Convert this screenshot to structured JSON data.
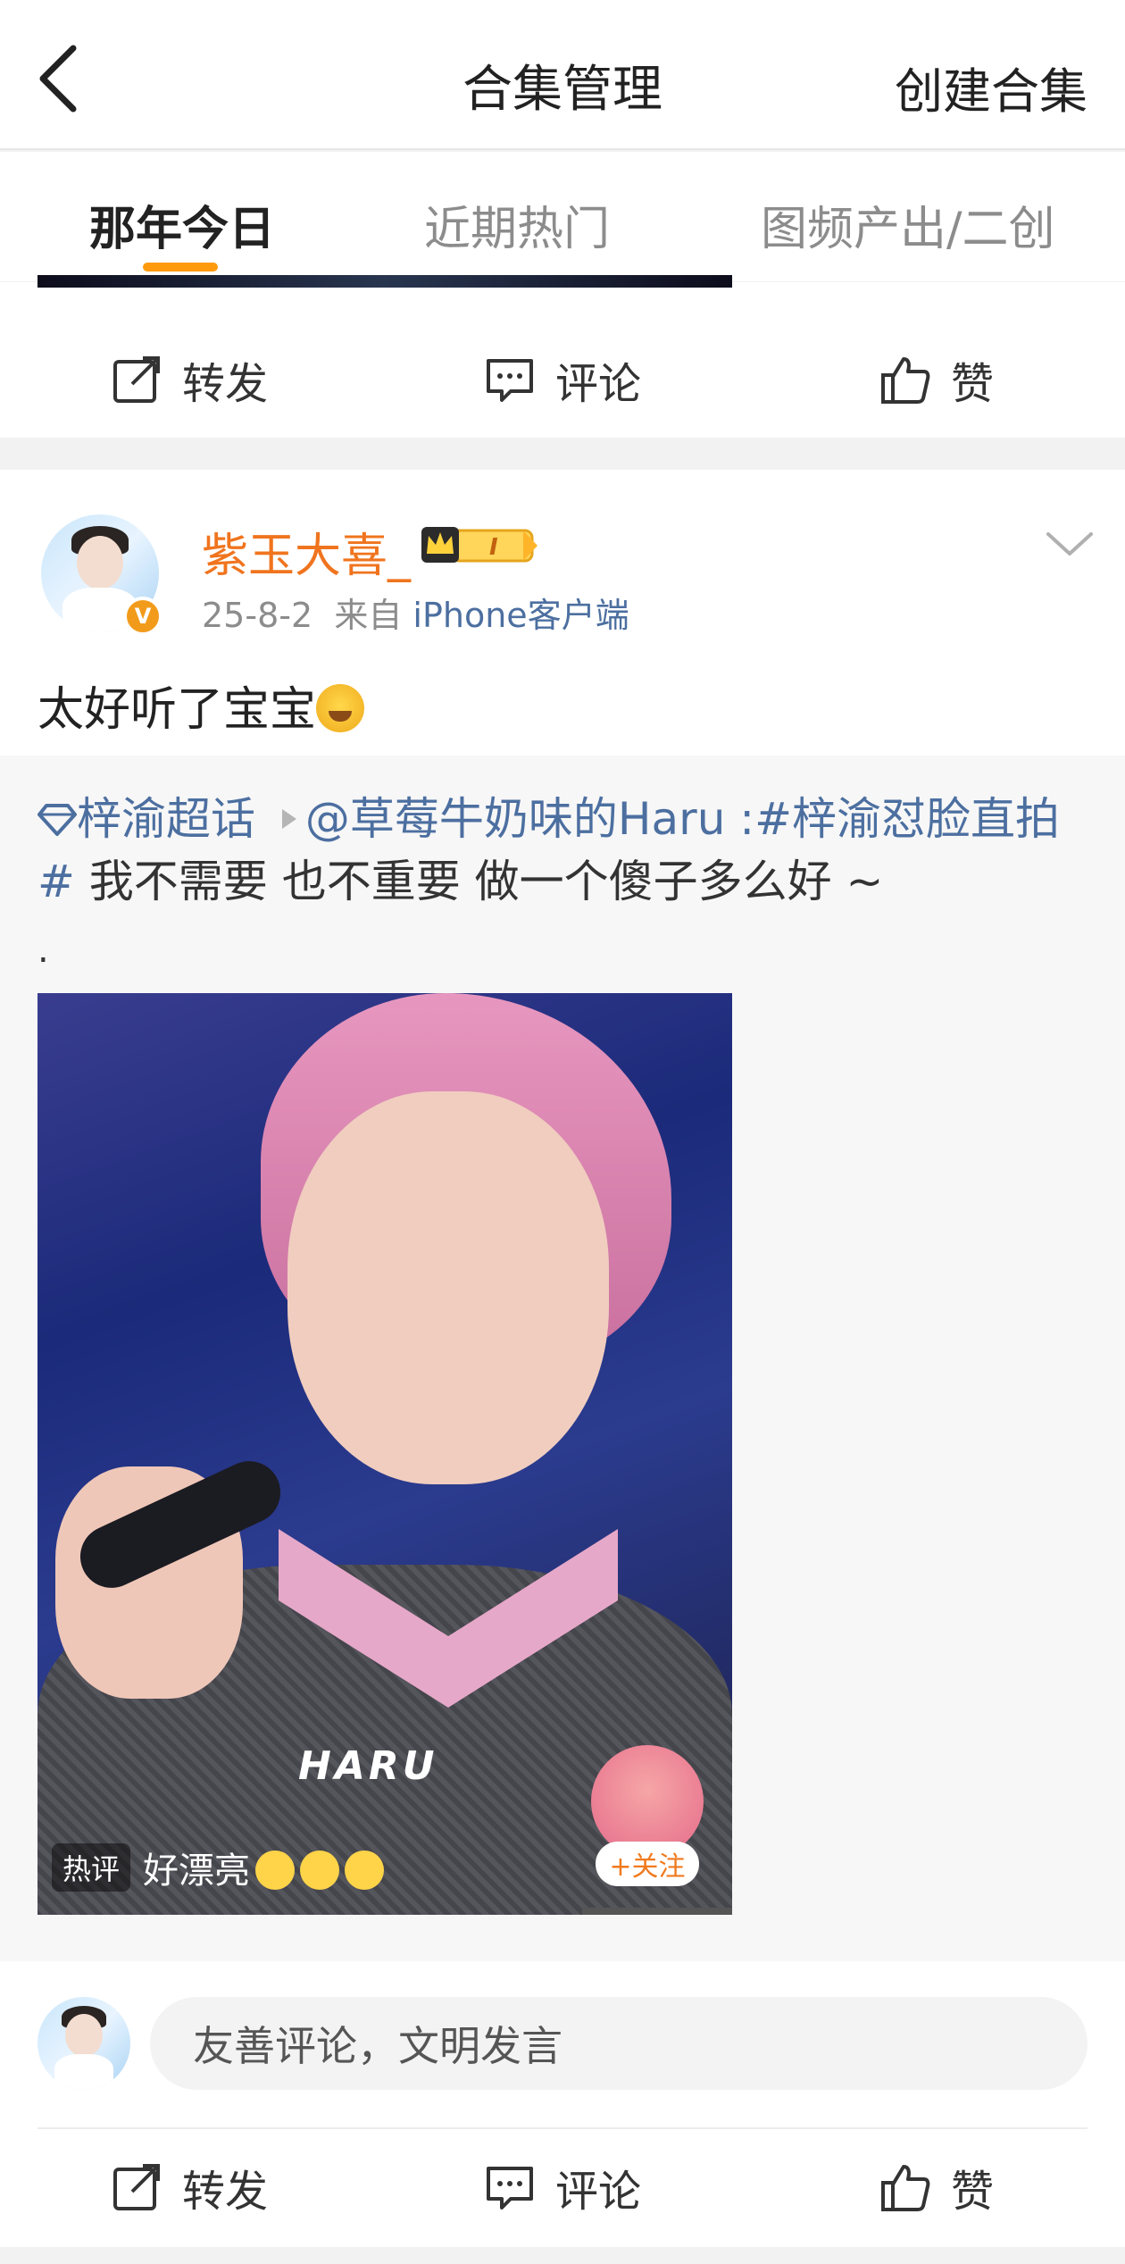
{
  "header": {
    "title": "合集管理",
    "create_label": "创建合集"
  },
  "tabs": [
    {
      "label": "那年今日",
      "active": true
    },
    {
      "label": "近期热门",
      "active": false
    },
    {
      "label": "图频产出/二创",
      "active": false
    }
  ],
  "actions": {
    "repost": "转发",
    "comment": "评论",
    "like": "赞"
  },
  "post": {
    "username": "紫玉大喜_",
    "level_badge": "I",
    "date": "25-8-2",
    "source_prefix": "来自",
    "source": "iPhone客户端",
    "text": "太好听了宝宝",
    "repost": {
      "topic": "梓渝超话",
      "mention": "@草莓牛奶味的Haru",
      "separator": " :",
      "hashtag": "#梓渝怼脸直拍#",
      "body": " 我不需要 也不重要 做一个傻子多么好 ~",
      "trailing": "."
    },
    "video": {
      "logo_text": "HARU",
      "hot_tag": "热评",
      "hot_comment": "好漂亮",
      "follow_label": "+关注"
    }
  },
  "comment_box": {
    "placeholder": "友善评论，文明发言"
  },
  "colors": {
    "accent": "#ff9a0e",
    "username": "#f0741e",
    "link": "#4c6fa0"
  }
}
